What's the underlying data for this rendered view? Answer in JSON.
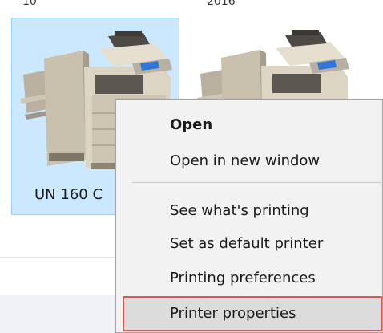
{
  "window": {
    "top_cut_left": "10",
    "top_cut_right": "2016"
  },
  "printers": [
    {
      "name": "UN 160 C",
      "selected": true
    },
    {
      "name": "",
      "selected": false
    }
  ],
  "context_menu": {
    "items": [
      {
        "label": "Open",
        "bold": true
      },
      {
        "label": "Open in new window",
        "bold": false
      },
      {
        "label": "See what's printing",
        "bold": false
      },
      {
        "label": "Set as default printer",
        "bold": false
      },
      {
        "label": "Printing preferences",
        "bold": false
      },
      {
        "label": "Printer properties",
        "bold": false,
        "highlighted": true
      }
    ]
  },
  "colors": {
    "selection_bg": "#cce8ff",
    "selection_border": "#99d1ff",
    "highlight_border": "#e0574f",
    "menu_bg": "#f2f2f2"
  },
  "icons": {
    "printer_left": "multifunction-printer-icon",
    "printer_right": "multifunction-printer-icon"
  }
}
